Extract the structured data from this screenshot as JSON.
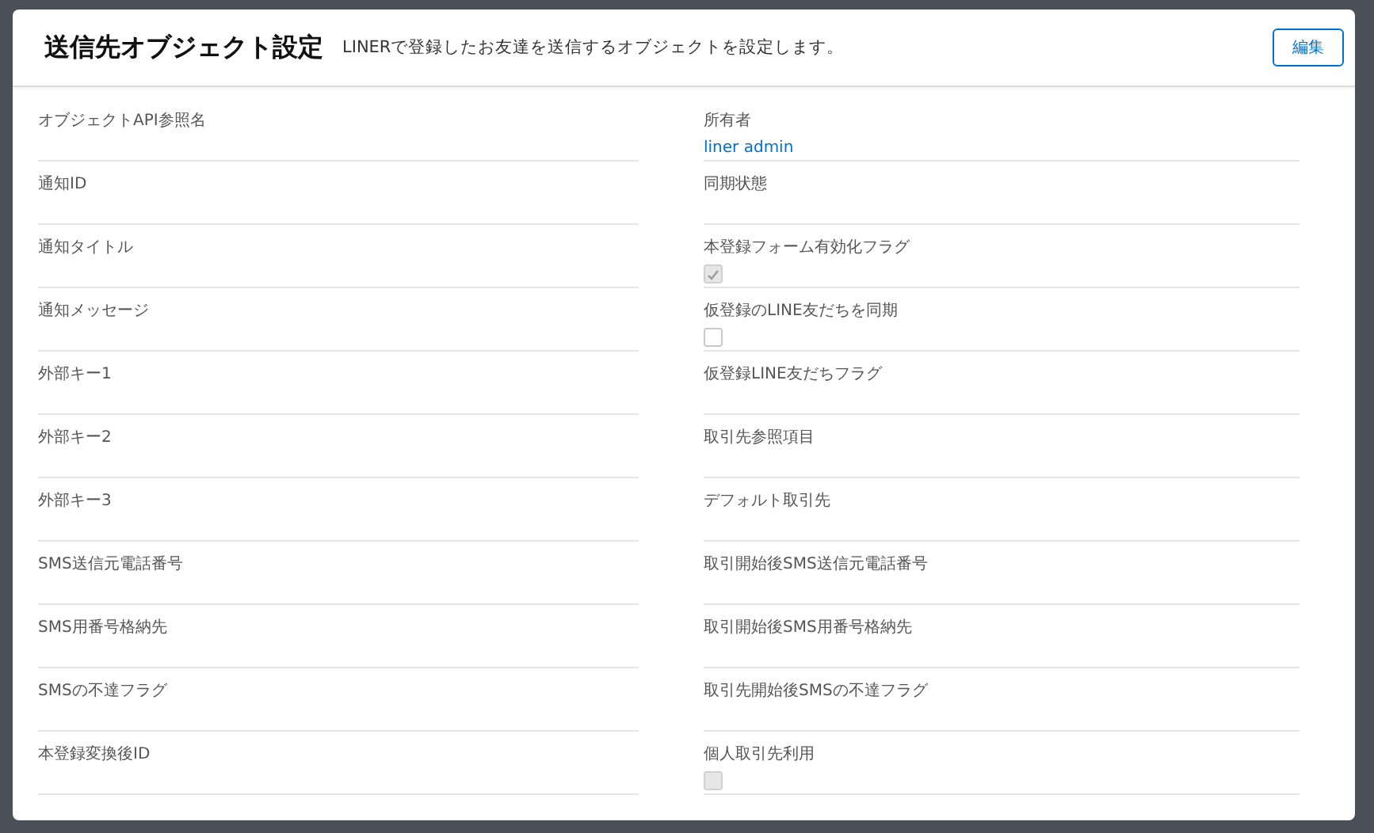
{
  "modal": {
    "title": "送信先オブジェクト設定",
    "subtitle": "LINERで登録したお友達を送信するオブジェクトを設定します。",
    "edit_button": "編集"
  },
  "fields": [
    {
      "kind": "text",
      "label": "オブジェクトAPI参照名"
    },
    {
      "kind": "link",
      "label": "所有者",
      "value": "liner admin"
    },
    {
      "kind": "text",
      "label": "通知ID"
    },
    {
      "kind": "text",
      "label": "同期状態"
    },
    {
      "kind": "text",
      "label": "通知タイトル"
    },
    {
      "kind": "checkbox",
      "label": "本登録フォーム有効化フラグ",
      "checked": true,
      "disabled": true
    },
    {
      "kind": "text",
      "label": "通知メッセージ"
    },
    {
      "kind": "checkbox",
      "label": "仮登録のLINE友だちを同期",
      "checked": false,
      "disabled": false
    },
    {
      "kind": "text",
      "label": "外部キー1"
    },
    {
      "kind": "text",
      "label": "仮登録LINE友だちフラグ"
    },
    {
      "kind": "text",
      "label": "外部キー2"
    },
    {
      "kind": "text",
      "label": "取引先参照項目"
    },
    {
      "kind": "text",
      "label": "外部キー3"
    },
    {
      "kind": "text",
      "label": "デフォルト取引先"
    },
    {
      "kind": "text",
      "label": "SMS送信元電話番号"
    },
    {
      "kind": "text",
      "label": "取引開始後SMS送信元電話番号"
    },
    {
      "kind": "text",
      "label": "SMS用番号格納先"
    },
    {
      "kind": "text",
      "label": "取引開始後SMS用番号格納先"
    },
    {
      "kind": "text",
      "label": "SMSの不達フラグ"
    },
    {
      "kind": "text",
      "label": "取引先開始後SMSの不達フラグ"
    },
    {
      "kind": "text",
      "label": "本登録変換後ID"
    },
    {
      "kind": "checkbox",
      "label": "個人取引先利用",
      "checked": false,
      "disabled": true
    }
  ]
}
